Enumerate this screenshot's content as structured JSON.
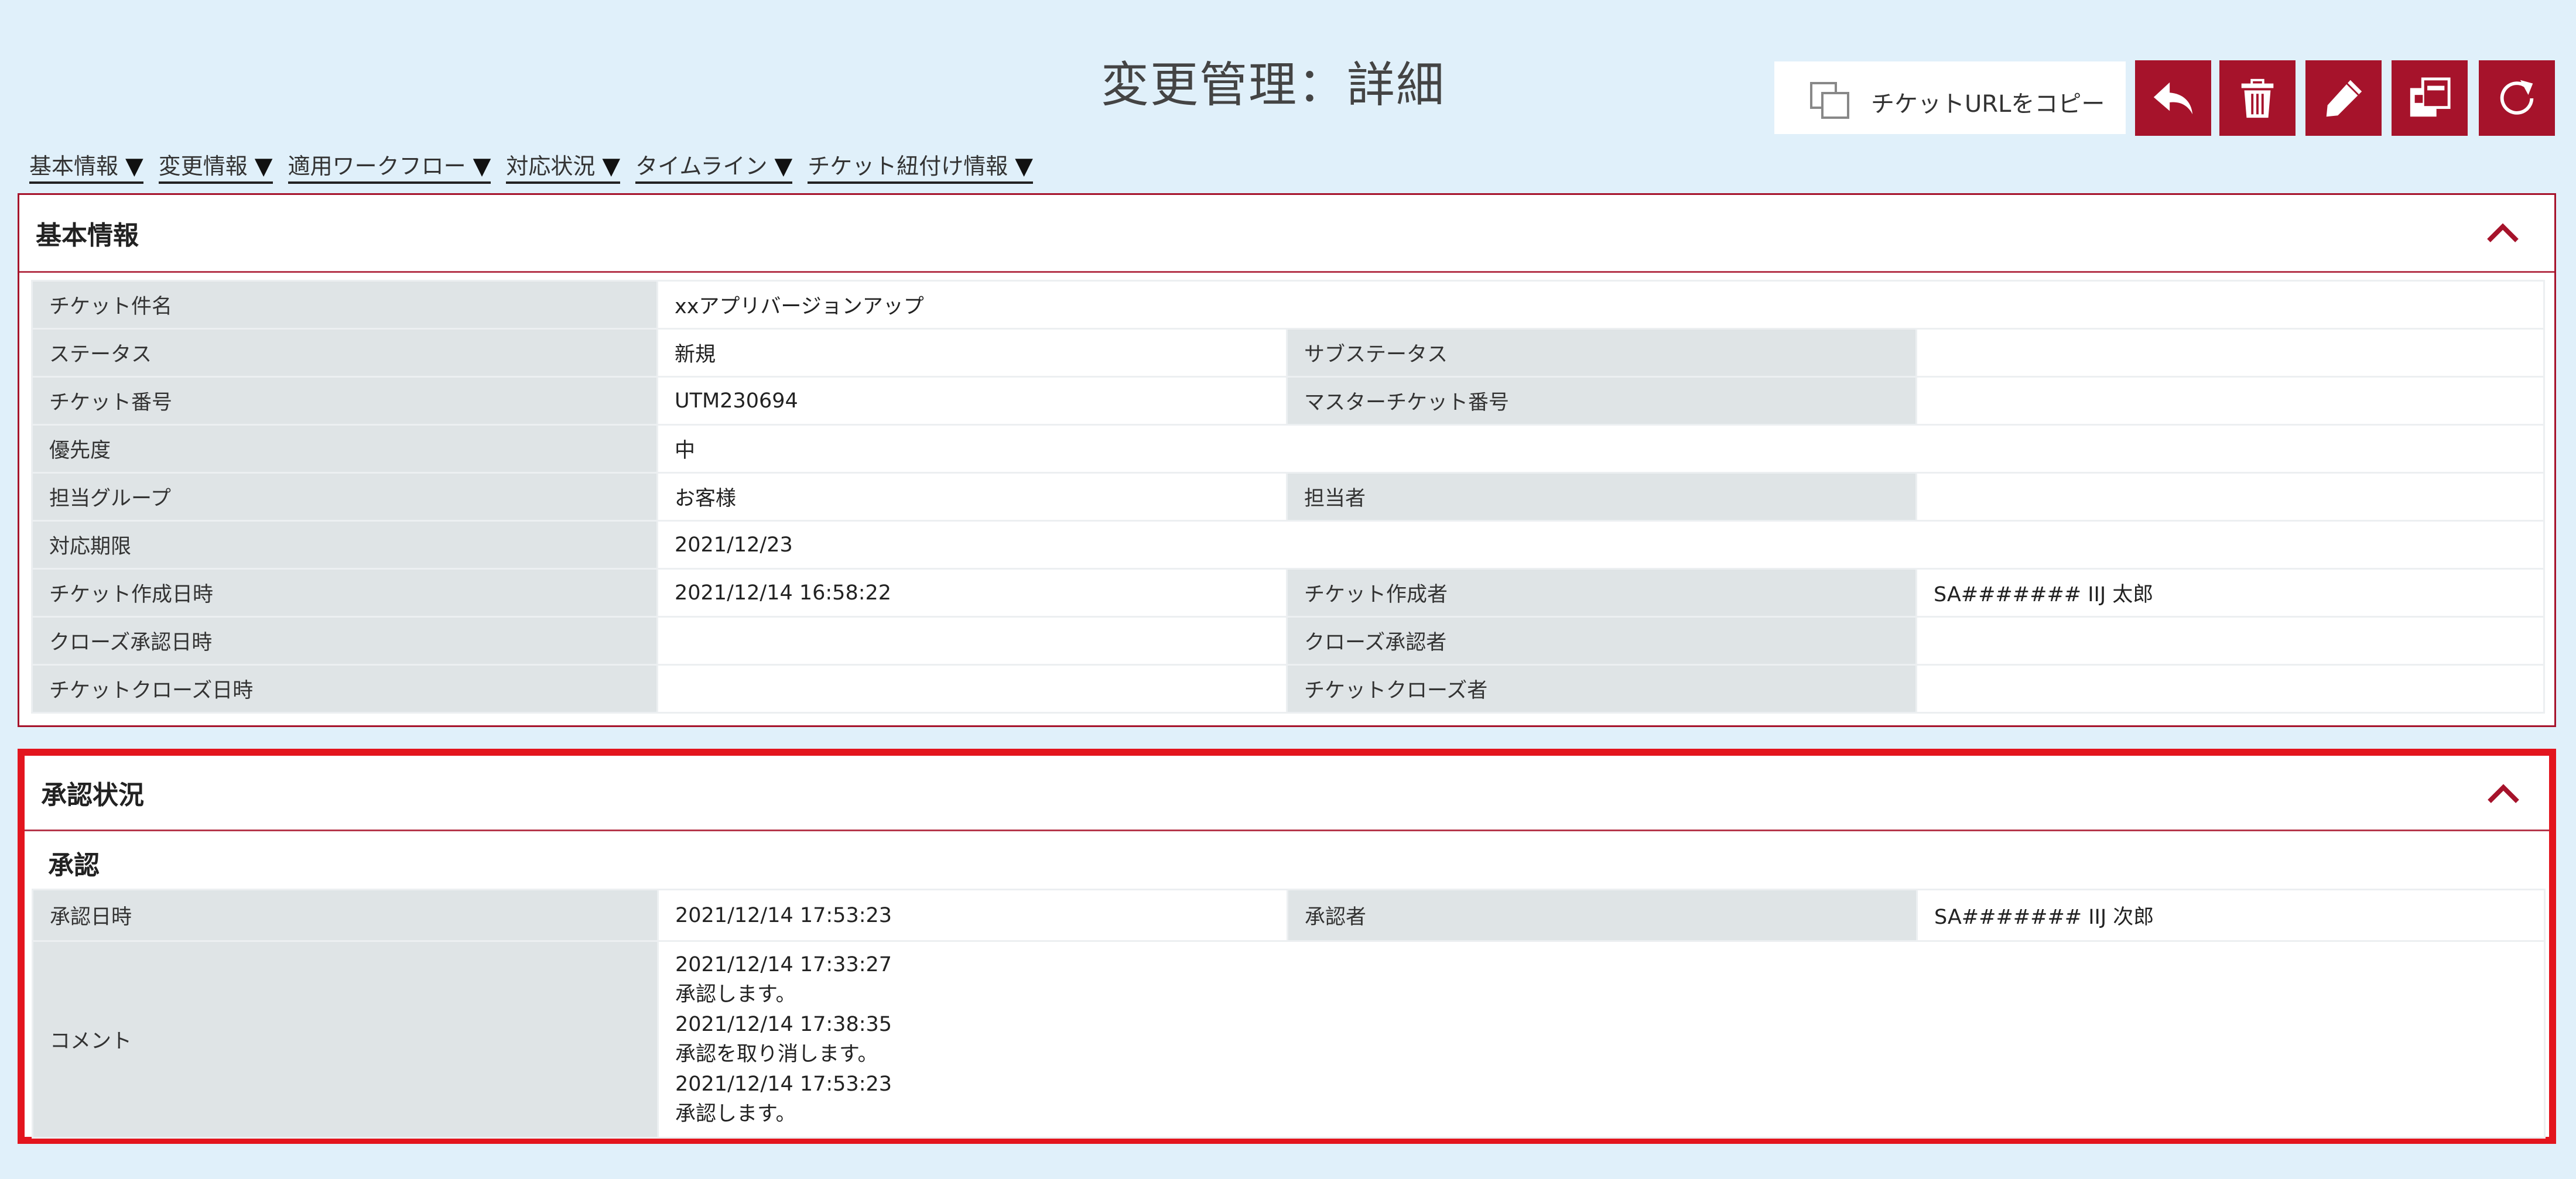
{
  "page": {
    "title": "変更管理：詳細"
  },
  "toolbar": {
    "copy_url_label": "チケットURLをコピー",
    "buttons": [
      {
        "name": "back",
        "icon": "reply-arrow-icon"
      },
      {
        "name": "delete",
        "icon": "trash-icon"
      },
      {
        "name": "edit",
        "icon": "pencil-icon"
      },
      {
        "name": "copy-ticket",
        "icon": "duplicate-icon"
      },
      {
        "name": "refresh",
        "icon": "refresh-icon"
      }
    ],
    "accent_color": "#a6132b"
  },
  "nav": {
    "items": [
      {
        "label": "基本情報"
      },
      {
        "label": "変更情報"
      },
      {
        "label": "適用ワークフロー"
      },
      {
        "label": "対応状況"
      },
      {
        "label": "タイムライン"
      },
      {
        "label": "チケット紐付け情報"
      }
    ],
    "arrow": "▼"
  },
  "basic_info": {
    "title": "基本情報",
    "ticket_subject": {
      "label": "チケット件名",
      "value": "xxアプリバージョンアップ"
    },
    "status": {
      "label": "ステータス",
      "value": "新規"
    },
    "sub_status": {
      "label": "サブステータス",
      "value": ""
    },
    "ticket_number": {
      "label": "チケット番号",
      "value": "UTM230694"
    },
    "master_ticket_number": {
      "label": "マスターチケット番号",
      "value": ""
    },
    "priority": {
      "label": "優先度",
      "value": "中"
    },
    "assigned_group": {
      "label": "担当グループ",
      "value": "お客様"
    },
    "assignee": {
      "label": "担当者",
      "value": ""
    },
    "deadline": {
      "label": "対応期限",
      "value": "2021/12/23"
    },
    "created_at": {
      "label": "チケット作成日時",
      "value": "2021/12/14 16:58:22"
    },
    "created_by": {
      "label": "チケット作成者",
      "value": "SA####### IIJ 太郎"
    },
    "close_approved_at": {
      "label": "クローズ承認日時",
      "value": ""
    },
    "close_approver": {
      "label": "クローズ承認者",
      "value": ""
    },
    "closed_at": {
      "label": "チケットクローズ日時",
      "value": ""
    },
    "closed_by": {
      "label": "チケットクローズ者",
      "value": ""
    }
  },
  "approval": {
    "title": "承認状況",
    "subtitle": "承認",
    "approved_at": {
      "label": "承認日時",
      "value": "2021/12/14 17:53:23"
    },
    "approver": {
      "label": "承認者",
      "value": "SA####### IIJ 次郎"
    },
    "comment": {
      "label": "コメント",
      "lines": [
        "2021/12/14 17:33:27",
        "承認します。",
        "2021/12/14 17:38:35",
        "承認を取り消します。",
        "2021/12/14 17:53:23",
        "承認します。"
      ]
    },
    "highlight_color": "#e3151e"
  }
}
